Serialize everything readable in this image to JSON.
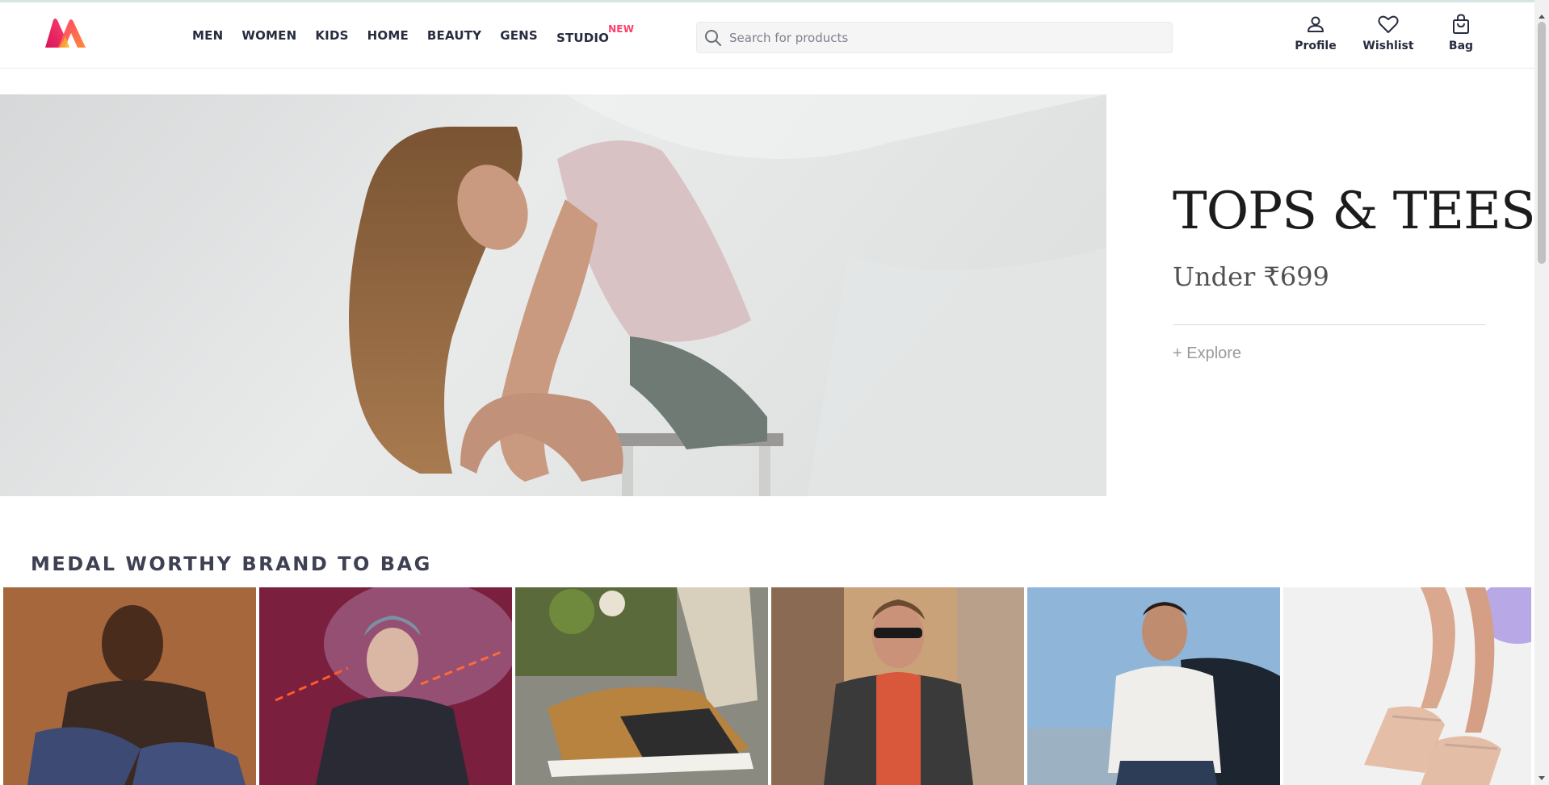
{
  "header": {
    "logo_name": "myntra-logo",
    "nav": [
      {
        "label": "MEN"
      },
      {
        "label": "WOMEN"
      },
      {
        "label": "KIDS"
      },
      {
        "label": "HOME"
      },
      {
        "label": "BEAUTY"
      },
      {
        "label": "GENS"
      },
      {
        "label": "STUDIO",
        "badge": "NEW"
      }
    ],
    "search": {
      "placeholder": "Search for products"
    },
    "actions": [
      {
        "label": "Profile",
        "icon": "profile-icon"
      },
      {
        "label": "Wishlist",
        "icon": "heart-icon"
      },
      {
        "label": "Bag",
        "icon": "bag-icon"
      }
    ]
  },
  "hero": {
    "title": "TOPS & TEES",
    "subtitle": "Under ₹699",
    "cta": "+ Explore"
  },
  "section": {
    "title": "MEDAL WORTHY BRAND TO BAG"
  },
  "colors": {
    "brand_pink": "#ff3f6c",
    "brand_orange": "#f26a10",
    "text_dark": "#282c3f"
  }
}
